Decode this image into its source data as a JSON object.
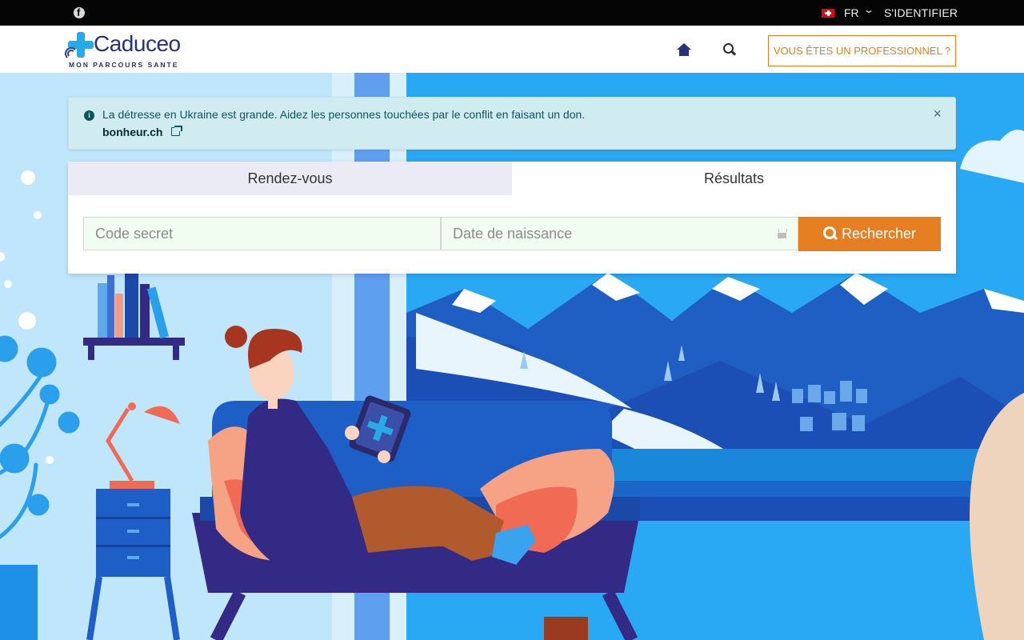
{
  "topbar": {
    "social_icon": "facebook-icon",
    "flag_icon": "swiss-flag-icon",
    "language": "FR",
    "login_label": "S'IDENTIFIER"
  },
  "header": {
    "logo_name": "Caduceo",
    "logo_tagline": "MON PARCOURS SANTE",
    "home_icon": "home-icon",
    "search_icon": "search-icon",
    "pro_button_label": "VOUS ÊTES UN PROFESSIONNEL ?"
  },
  "alert": {
    "message": "La détresse en Ukraine est grande. Aidez les personnes touchées par le conflit en faisant un don.",
    "link_label": "bonheur.ch",
    "close_symbol": "×"
  },
  "search": {
    "tabs": [
      {
        "label": "Rendez-vous",
        "active": false
      },
      {
        "label": "Résultats",
        "active": true
      }
    ],
    "code_placeholder": "Code secret",
    "birthdate_placeholder": "Date de naissance",
    "button_label": "Rechercher"
  },
  "colors": {
    "brand_blue": "#263378",
    "accent_orange": "#e67e22",
    "alert_bg": "#d1ecf1",
    "sky": "#29a9f3"
  }
}
